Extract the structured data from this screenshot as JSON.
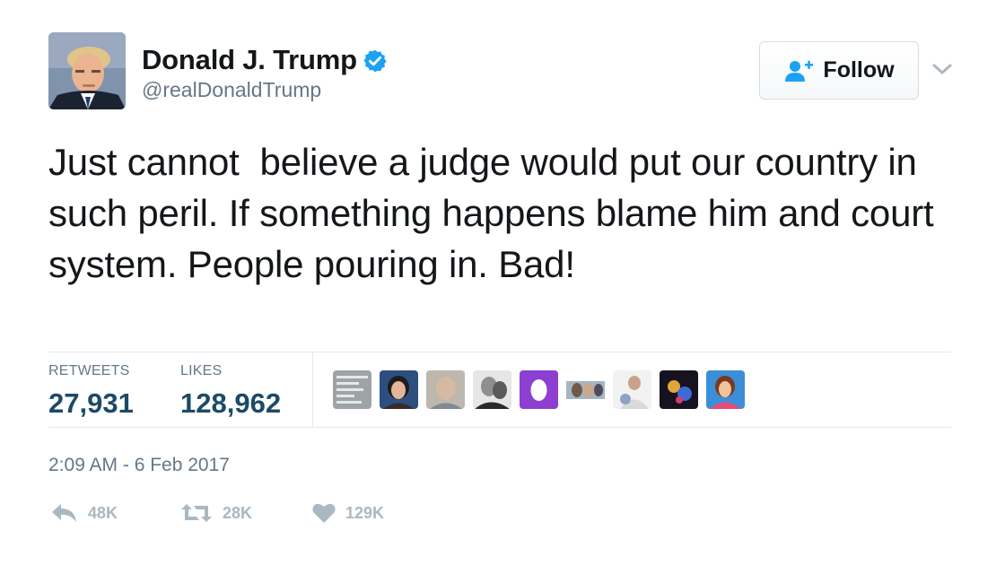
{
  "user": {
    "display_name": "Donald J. Trump",
    "handle": "@realDonaldTrump",
    "verified": true,
    "avatar_icon": "profile-photo"
  },
  "follow_button": {
    "label": "Follow",
    "icon": "add-user-icon"
  },
  "menu_caret": {
    "icon": "chevron-down-icon"
  },
  "tweet": {
    "text": "Just cannot  believe a judge would put our country in such peril. If something happens blame him and court system. People pouring in. Bad!"
  },
  "stats": {
    "retweets": {
      "label": "RETWEETS",
      "value": "27,931"
    },
    "likes": {
      "label": "LIKES",
      "value": "128,962"
    }
  },
  "likers_count_shown": 9,
  "timestamp": "2:09 AM - 6 Feb 2017",
  "actions": {
    "reply": {
      "icon": "reply-icon",
      "count": "48K"
    },
    "retweet": {
      "icon": "retweet-icon",
      "count": "28K"
    },
    "like": {
      "icon": "heart-icon",
      "count": "129K"
    }
  },
  "colors": {
    "text_primary": "#14171a",
    "text_secondary": "#657786",
    "stat_value": "#1c4a66",
    "verified_blue": "#1da1f2",
    "action_gray": "#aab8c2",
    "divider": "#e1e8ed"
  }
}
